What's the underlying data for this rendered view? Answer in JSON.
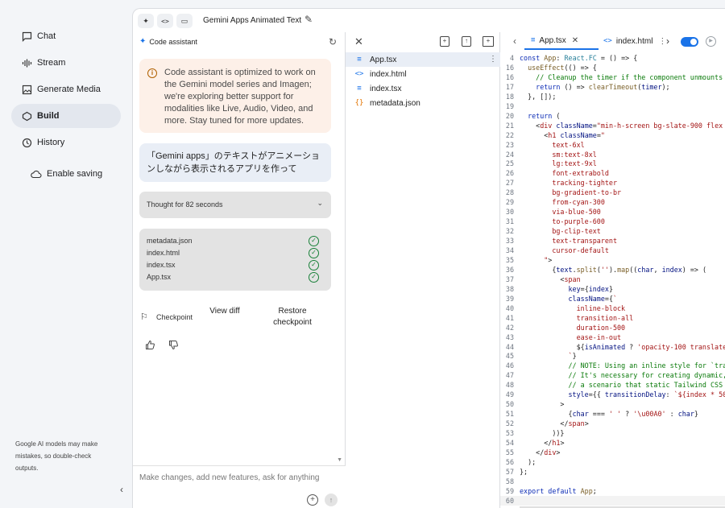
{
  "nav": {
    "items": [
      {
        "label": "Chat",
        "icon": "chat-icon"
      },
      {
        "label": "Stream",
        "icon": "stream-icon"
      },
      {
        "label": "Generate Media",
        "icon": "media-icon"
      },
      {
        "label": "Build",
        "icon": "build-icon",
        "active": true
      },
      {
        "label": "History",
        "icon": "history-icon"
      }
    ],
    "enable_saving": "Enable saving",
    "note": "Google AI models may make mistakes, so double-check outputs."
  },
  "topbar": {
    "title": "Gemini Apps Animated Text"
  },
  "chat": {
    "header": "Code assistant",
    "info": "Code assistant is optimized to work on the Gemini model series and Imagen; we're exploring better support for modalities like Live, Audio, Video, and more. Stay tuned for more updates.",
    "user_message": "「Gemini apps」のテキストがアニメーションしながら表示されるアプリを作って",
    "thought": "Thought for 82 seconds",
    "files": [
      "metadata.json",
      "index.html",
      "index.tsx",
      "App.tsx"
    ],
    "checkpoint": "Checkpoint",
    "view_diff": "View diff",
    "restore": "Restore checkpoint",
    "input_placeholder": "Make changes, add new features, ask for anything"
  },
  "explorer": {
    "files": [
      {
        "name": "App.tsx",
        "icon": "≡",
        "selected": true
      },
      {
        "name": "index.html",
        "icon": "<>",
        "selected": false
      },
      {
        "name": "index.tsx",
        "icon": "≡",
        "selected": false
      },
      {
        "name": "metadata.json",
        "icon": "{}",
        "selected": false
      }
    ]
  },
  "editor": {
    "tabs": [
      {
        "label": "App.tsx",
        "icon": "≡",
        "close": "✕"
      },
      {
        "label": "index.html",
        "icon": "<>",
        "close": "⋮"
      }
    ],
    "current_line": "60",
    "lines": [
      {
        "n": "4",
        "html": "<span class='k'>const</span> <span class='fn'>App</span>: <span class='p'>React.FC</span> = () =&gt; {"
      },
      {
        "n": "16",
        "html": "  <span class='fn'>useEffect</span>(() =&gt; {"
      },
      {
        "n": "16",
        "html": "    <span class='c'>// Cleanup the timer if the component unmounts</span>"
      },
      {
        "n": "17",
        "html": "    <span class='k'>return</span> () =&gt; <span class='fn'>clearTimeout</span>(<span class='t'>timer</span>);"
      },
      {
        "n": "18",
        "html": "  }, []);"
      },
      {
        "n": "19",
        "html": ""
      },
      {
        "n": "20",
        "html": "  <span class='k'>return</span> ("
      },
      {
        "n": "21",
        "html": "    &lt;<span class='s'>div</span> <span class='t'>className</span>=<span class='s'>\"min-h-screen bg-slate-900 flex i</span>"
      },
      {
        "n": "22",
        "html": "      &lt;<span class='s'>h1</span> <span class='t'>className</span>=<span class='s'>\"</span>"
      },
      {
        "n": "23",
        "html": "<span class='s'>        text-6xl</span>"
      },
      {
        "n": "24",
        "html": "<span class='s'>        sm:text-8xl</span>"
      },
      {
        "n": "25",
        "html": "<span class='s'>        lg:text-9xl</span>"
      },
      {
        "n": "26",
        "html": "<span class='s'>        font-extrabold</span>"
      },
      {
        "n": "27",
        "html": "<span class='s'>        tracking-tighter</span>"
      },
      {
        "n": "28",
        "html": "<span class='s'>        bg-gradient-to-br</span>"
      },
      {
        "n": "29",
        "html": "<span class='s'>        from-cyan-300</span>"
      },
      {
        "n": "30",
        "html": "<span class='s'>        via-blue-500</span>"
      },
      {
        "n": "31",
        "html": "<span class='s'>        to-purple-600</span>"
      },
      {
        "n": "32",
        "html": "<span class='s'>        bg-clip-text</span>"
      },
      {
        "n": "33",
        "html": "<span class='s'>        text-transparent</span>"
      },
      {
        "n": "34",
        "html": "<span class='s'>        cursor-default</span>"
      },
      {
        "n": "35",
        "html": "<span class='s'>      \"</span>&gt;"
      },
      {
        "n": "36",
        "html": "        {<span class='t'>text</span>.<span class='fn'>split</span>(<span class='s'>''</span>).<span class='fn'>map</span>((<span class='t'>char</span>, <span class='t'>index</span>) =&gt; ("
      },
      {
        "n": "37",
        "html": "          &lt;<span class='s'>span</span>"
      },
      {
        "n": "38",
        "html": "            <span class='t'>key</span>={<span class='t'>index</span>}"
      },
      {
        "n": "39",
        "html": "            <span class='t'>className</span>={<span class='s'>`</span>"
      },
      {
        "n": "40",
        "html": "<span class='s'>              inline-block</span>"
      },
      {
        "n": "41",
        "html": "<span class='s'>              transition-all</span>"
      },
      {
        "n": "42",
        "html": "<span class='s'>              duration-500</span>"
      },
      {
        "n": "43",
        "html": "<span class='s'>              ease-in-out</span>"
      },
      {
        "n": "44",
        "html": "              ${<span class='t'>isAnimated</span> ? <span class='s'>'opacity-100 translate-</span>"
      },
      {
        "n": "45",
        "html": "<span class='s'>            `</span>}"
      },
      {
        "n": "46",
        "html": "            <span class='c'>// NOTE: Using an inline style for `tran</span>"
      },
      {
        "n": "47",
        "html": "            <span class='c'>// It's necessary for creating dynamic,</span>"
      },
      {
        "n": "48",
        "html": "            <span class='c'>// a scenario that static Tailwind CSS c</span>"
      },
      {
        "n": "49",
        "html": "            <span class='t'>style</span>={{ <span class='t'>transitionDelay</span>: <span class='s'>`${index * 50}</span>"
      },
      {
        "n": "50",
        "html": "          &gt;"
      },
      {
        "n": "51",
        "html": "            {<span class='t'>char</span> === <span class='s'>' '</span> ? <span class='s'>'\\u00A0'</span> : <span class='t'>char</span>}"
      },
      {
        "n": "52",
        "html": "          &lt;/<span class='s'>span</span>&gt;"
      },
      {
        "n": "53",
        "html": "        ))}"
      },
      {
        "n": "54",
        "html": "      &lt;/<span class='s'>h1</span>&gt;"
      },
      {
        "n": "55",
        "html": "    &lt;/<span class='s'>div</span>&gt;"
      },
      {
        "n": "56",
        "html": "  );"
      },
      {
        "n": "57",
        "html": "};"
      },
      {
        "n": "58",
        "html": ""
      },
      {
        "n": "59",
        "html": "<span class='k'>export default</span> <span class='fn'>App</span>;"
      },
      {
        "n": "60",
        "html": ""
      }
    ]
  }
}
